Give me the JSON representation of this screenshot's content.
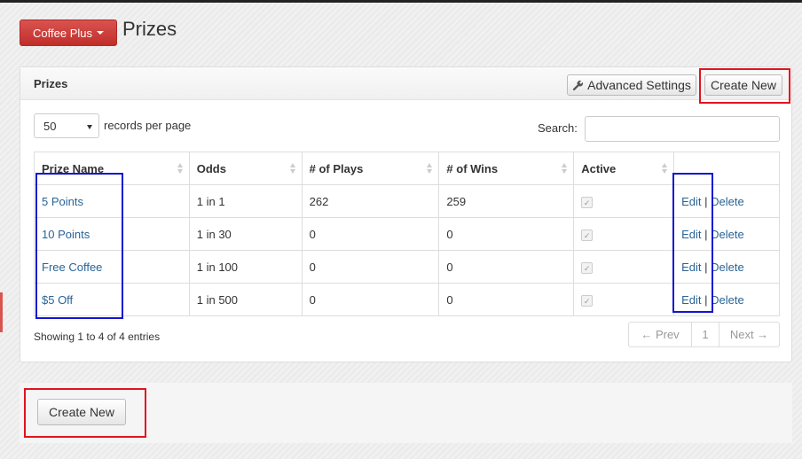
{
  "app_menu": {
    "label": "Coffee Plus"
  },
  "page": {
    "title": "Prizes"
  },
  "panel": {
    "title": "Prizes",
    "advanced_settings_label": "Advanced Settings",
    "create_new_label": "Create New"
  },
  "length": {
    "value": "50",
    "label": "records per page"
  },
  "search": {
    "label": "Search:",
    "value": "",
    "placeholder": ""
  },
  "table": {
    "columns": [
      "Prize Name",
      "Odds",
      "# of Plays",
      "# of Wins",
      "Active",
      ""
    ],
    "rows": [
      {
        "name": "5 Points",
        "odds": "1 in 1",
        "plays": "262",
        "wins": "259",
        "active": true,
        "edit": "Edit",
        "sep": "|",
        "delete": "Delete"
      },
      {
        "name": "10 Points",
        "odds": "1 in 30",
        "plays": "0",
        "wins": "0",
        "active": true,
        "edit": "Edit",
        "sep": "|",
        "delete": "Delete"
      },
      {
        "name": "Free Coffee",
        "odds": "1 in 100",
        "plays": "0",
        "wins": "0",
        "active": true,
        "edit": "Edit",
        "sep": "|",
        "delete": "Delete"
      },
      {
        "name": "$5 Off",
        "odds": "1 in 500",
        "plays": "0",
        "wins": "0",
        "active": true,
        "edit": "Edit",
        "sep": "|",
        "delete": "Delete"
      }
    ]
  },
  "info": "Showing 1 to 4 of 4 entries",
  "pagination": {
    "prev": "← Prev",
    "page": "1",
    "next": "Next →"
  },
  "footer": {
    "create_new_label": "Create New"
  },
  "colors": {
    "brand_red": "#d9534f",
    "link": "#2a6496",
    "highlight_red": "#e0141e",
    "highlight_blue": "#1414d2"
  }
}
